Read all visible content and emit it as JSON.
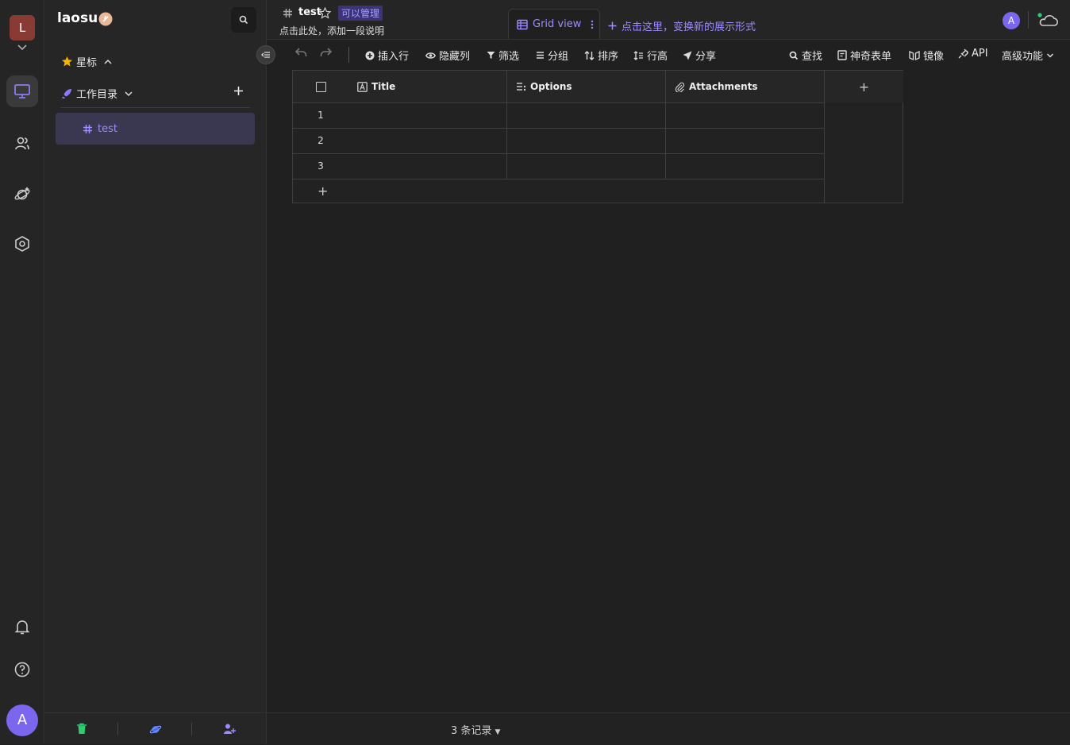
{
  "rail": {
    "logo_letter": "L",
    "user_initial": "A"
  },
  "sidebar": {
    "space_name": "laosu",
    "starred_label": "星标",
    "catalog_label": "工作目录",
    "items": [
      {
        "label": "test"
      }
    ]
  },
  "header": {
    "datasheet_title": "test",
    "permission_badge": "可以管理",
    "description": "点击此处，添加一段说明",
    "active_view": "Grid view",
    "add_view_label": "点击这里，变换新的展示形式",
    "avatar_initial": "A"
  },
  "toolbar": {
    "insert_row": "插入行",
    "hide_columns": "隐藏列",
    "filter": "筛选",
    "group": "分组",
    "sort": "排序",
    "row_height": "行高",
    "share": "分享",
    "find": "查找",
    "form": "神奇表单",
    "mirror": "镜像",
    "api": "API",
    "advanced": "高级功能"
  },
  "grid": {
    "columns": [
      {
        "name": "Title",
        "icon": "text-field-icon"
      },
      {
        "name": "Options",
        "icon": "multi-select-icon"
      },
      {
        "name": "Attachments",
        "icon": "attachment-icon"
      }
    ],
    "rows": [
      {
        "index": "1",
        "title": "",
        "options": "",
        "attachments": ""
      },
      {
        "index": "2",
        "title": "",
        "options": "",
        "attachments": ""
      },
      {
        "index": "3",
        "title": "",
        "options": "",
        "attachments": ""
      }
    ],
    "add_column_label": "+",
    "add_row_label": "+"
  },
  "status": {
    "record_count": "3 条记录"
  },
  "colors": {
    "accent": "#7b67ee",
    "accent_text": "#9b8cff",
    "background": "#202020",
    "trash_green": "#2ecc71",
    "online_dot": "#2ecc71"
  }
}
